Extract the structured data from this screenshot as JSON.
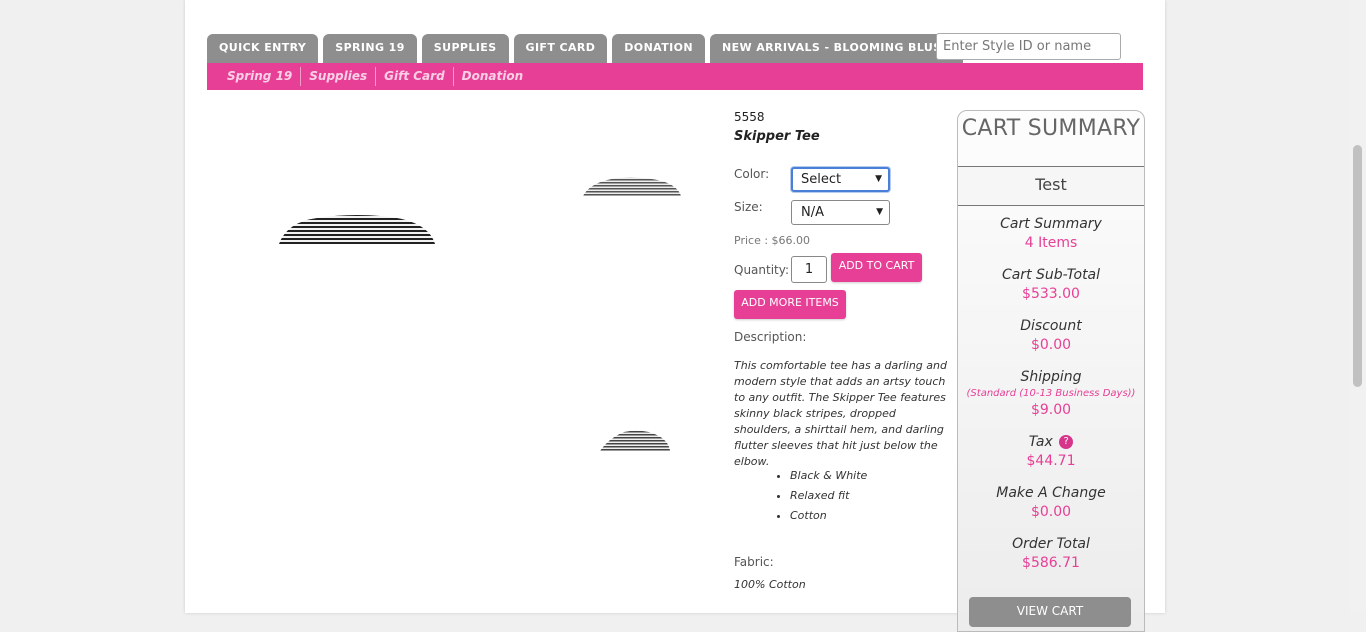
{
  "tabs": [
    "QUICK ENTRY",
    "SPRING 19",
    "SUPPLIES",
    "GIFT CARD",
    "DONATION",
    "NEW ARRIVALS - BLOOMING BLUSH"
  ],
  "search": {
    "placeholder": "Enter Style ID or name"
  },
  "subnav": [
    "Spring 19",
    "Supplies",
    "Gift Card",
    "Donation"
  ],
  "product": {
    "style_id": "5558",
    "name": "Skipper Tee",
    "color_label": "Color:",
    "color_value": "Select",
    "size_label": "Size:",
    "size_value": "N/A",
    "price": "Price : $66.00",
    "quantity_label": "Quantity:",
    "quantity_value": "1",
    "add_to_cart": "ADD TO CART",
    "add_more": "ADD MORE ITEMS",
    "description_label": "Description:",
    "description": "This comfortable tee has a darling and modern style that adds an artsy touch to any outfit. The Skipper Tee features skinny black stripes, dropped shoulders, a shirttail hem, and darling flutter sleeves that hit just below the elbow.",
    "bullets": [
      "Black & White",
      "Relaxed fit",
      "Cotton"
    ],
    "fabric_label": "Fabric:",
    "fabric": "100% Cotton"
  },
  "cart": {
    "title": "CART SUMMARY",
    "user": "Test",
    "summary_label": "Cart Summary",
    "items": "4 Items",
    "subtotal_label": "Cart Sub-Total",
    "subtotal": "$533.00",
    "discount_label": "Discount",
    "discount": "$0.00",
    "shipping_label": "Shipping",
    "shipping_note": "(Standard (10-13 Business Days))",
    "shipping": "$9.00",
    "tax_label": "Tax",
    "tax": "$44.71",
    "change_label": "Make A Change",
    "change": "$0.00",
    "total_label": "Order Total",
    "total": "$586.71",
    "view_cart": "VIEW CART"
  },
  "colors": {
    "accent": "#e73f96",
    "tab": "#8e8e8e"
  }
}
